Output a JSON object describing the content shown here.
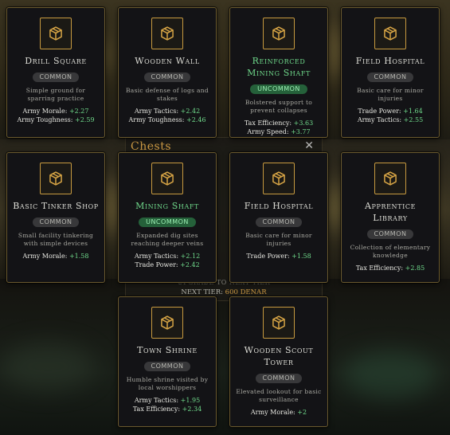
{
  "background_modal": {
    "title": "Chests",
    "close_glyph": "✕",
    "subtext": "UPGRADE TO NEXT TIER",
    "next_tier_label": "NEXT TIER:",
    "next_tier_value": "600 DENAR"
  },
  "colors": {
    "common_badge": "#38383a",
    "uncommon_badge": "#25613a",
    "stat_bonus": "#6fd98b",
    "card_border": "#6b5a2e",
    "icon_border": "#c79a3f"
  },
  "cards": [
    {
      "name": "Drill Square",
      "rarity": "COMMON",
      "description": "Simple ground for sparring practice",
      "stats": [
        {
          "label": "Army Morale:",
          "value": "+2.27"
        },
        {
          "label": "Army Toughness:",
          "value": "+2.59"
        }
      ]
    },
    {
      "name": "Wooden Wall",
      "rarity": "COMMON",
      "description": "Basic defense of logs and stakes",
      "stats": [
        {
          "label": "Army Tactics:",
          "value": "+2.42"
        },
        {
          "label": "Army Toughness:",
          "value": "+2.46"
        }
      ]
    },
    {
      "name": "Reinforced Mining Shaft",
      "rarity": "UNCOMMON",
      "description": "Bolstered support to prevent collapses",
      "stats": [
        {
          "label": "Tax Efficiency:",
          "value": "+3.63"
        },
        {
          "label": "Army Speed:",
          "value": "+3.77"
        }
      ]
    },
    {
      "name": "Field Hospital",
      "rarity": "COMMON",
      "description": "Basic care for minor injuries",
      "stats": [
        {
          "label": "Trade Power:",
          "value": "+1.64"
        },
        {
          "label": "Army Tactics:",
          "value": "+2.55"
        }
      ]
    },
    {
      "name": "Basic Tinker Shop",
      "rarity": "COMMON",
      "description": "Small facility tinkering with simple devices",
      "stats": [
        {
          "label": "Army Morale:",
          "value": "+1.58"
        }
      ]
    },
    {
      "name": "Mining Shaft",
      "rarity": "UNCOMMON",
      "description": "Expanded dig sites reaching deeper veins",
      "stats": [
        {
          "label": "Army Tactics:",
          "value": "+2.12"
        },
        {
          "label": "Trade Power:",
          "value": "+2.42"
        }
      ]
    },
    {
      "name": "Field Hospital",
      "rarity": "COMMON",
      "description": "Basic care for minor injuries",
      "stats": [
        {
          "label": "Trade Power:",
          "value": "+1.58"
        }
      ]
    },
    {
      "name": "Apprentice Library",
      "rarity": "COMMON",
      "description": "Collection of elementary knowledge",
      "stats": [
        {
          "label": "Tax Efficiency:",
          "value": "+2.85"
        }
      ]
    },
    {
      "name": "Town Shrine",
      "rarity": "COMMON",
      "description": "Humble shrine visited by local worshippers",
      "stats": [
        {
          "label": "Army Tactics:",
          "value": "+1.95"
        },
        {
          "label": "Tax Efficiency:",
          "value": "+2.34"
        }
      ]
    },
    {
      "name": "Wooden Scout Tower",
      "rarity": "COMMON",
      "description": "Elevated lookout for basic surveillance",
      "stats": [
        {
          "label": "Army Morale:",
          "value": "+2"
        }
      ]
    }
  ],
  "card_icon": "chest-box-icon"
}
